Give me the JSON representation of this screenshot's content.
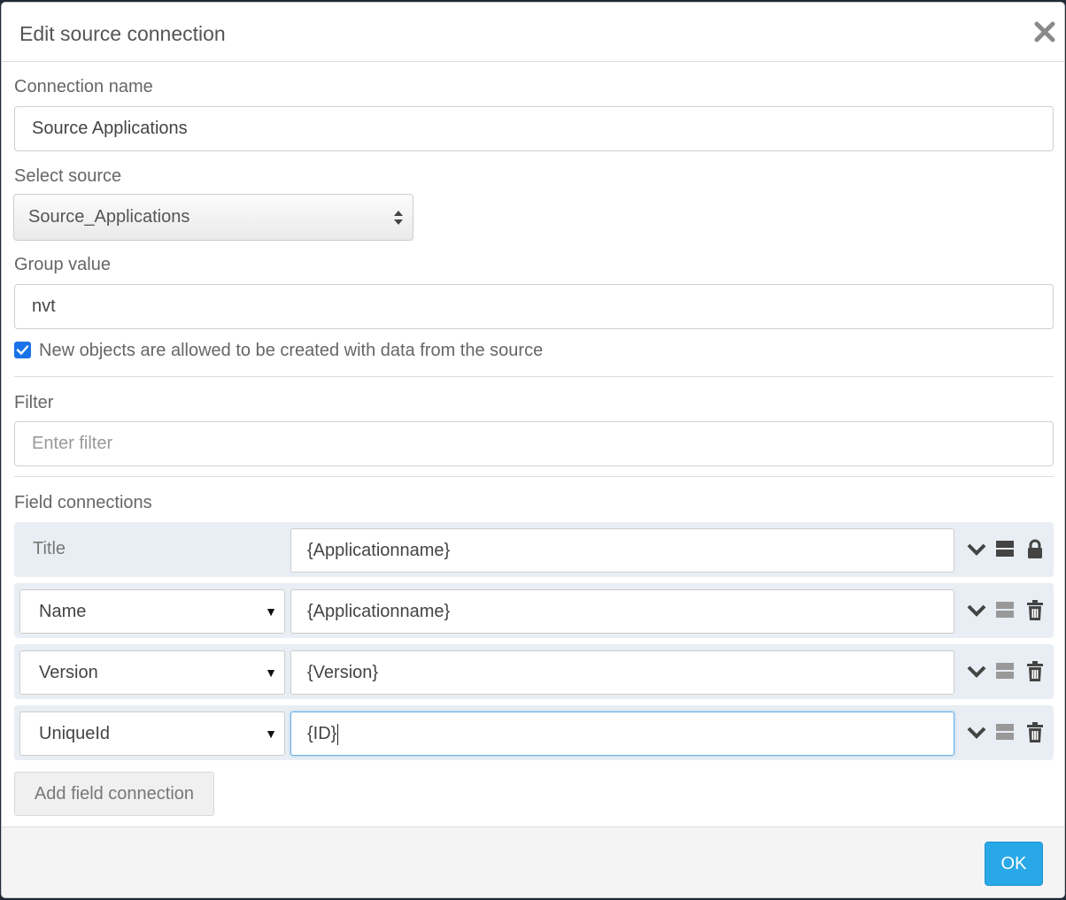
{
  "dialog": {
    "title": "Edit source connection"
  },
  "form": {
    "connection_name_label": "Connection name",
    "connection_name_value": "Source Applications",
    "select_source_label": "Select source",
    "select_source_value": "Source_Applications",
    "group_value_label": "Group value",
    "group_value_value": "nvt",
    "allow_new_objects_label": "New objects are allowed to be created with data from the source",
    "allow_new_objects_checked": true,
    "filter_label": "Filter",
    "filter_placeholder": "Enter filter",
    "filter_value": ""
  },
  "field_connections": {
    "label": "Field connections",
    "rows": [
      {
        "field": "Title",
        "value": "{Applicationname}",
        "locked": true,
        "end_icon": "lock-icon"
      },
      {
        "field": "Name",
        "value": "{Applicationname}",
        "locked": false,
        "end_icon": "trash-icon"
      },
      {
        "field": "Version",
        "value": "{Version}",
        "locked": false,
        "end_icon": "trash-icon"
      },
      {
        "field": "UniqueId",
        "value": "{ID}",
        "locked": false,
        "end_icon": "trash-icon",
        "focused": true
      }
    ],
    "add_button_label": "Add field connection"
  },
  "footer": {
    "ok_label": "OK"
  },
  "colors": {
    "accent": "#29a8e8",
    "checkbox": "#1a73e8",
    "row_bg": "#e8eef3"
  }
}
